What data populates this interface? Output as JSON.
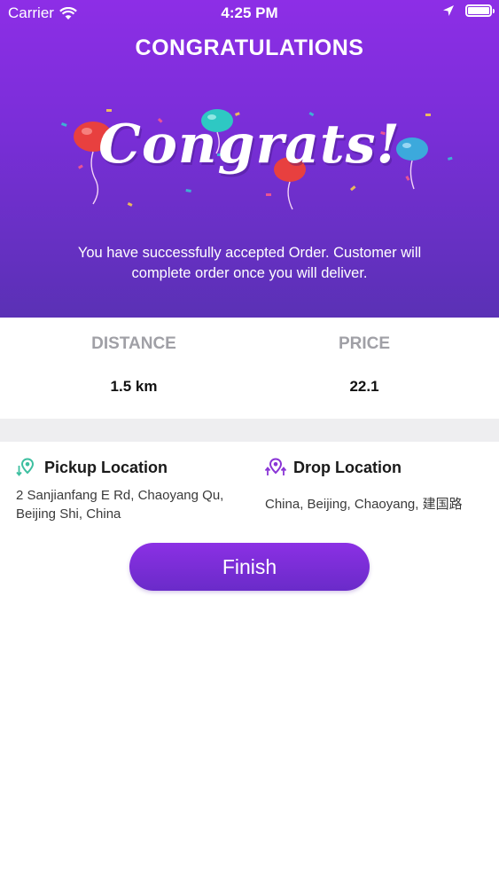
{
  "status_bar": {
    "carrier": "Carrier",
    "time": "4:25 PM"
  },
  "header": {
    "title": "CONGRATULATIONS",
    "banner_text": "Congrats!",
    "message": "You have successfully accepted Order. Customer will complete order once you will deliver."
  },
  "stats": {
    "distance_label": "DISTANCE",
    "distance_value": "1.5 km",
    "price_label": "PRICE",
    "price_value": "22.1"
  },
  "pickup": {
    "title": "Pickup Location",
    "address": "2 Sanjianfang E Rd, Chaoyang Qu, Beijing Shi, China",
    "icon": "pickup-pin-icon",
    "color": "#3dbfa0"
  },
  "drop": {
    "title": "Drop Location",
    "address": "China, Beijing, Chaoyang, 建国路",
    "icon": "drop-pin-icon",
    "color": "#8a35d6"
  },
  "actions": {
    "finish_label": "Finish"
  },
  "colors": {
    "gradient_top": "#8d2ee6",
    "gradient_bottom": "#5a31b5",
    "accent": "#7a2ed8"
  }
}
